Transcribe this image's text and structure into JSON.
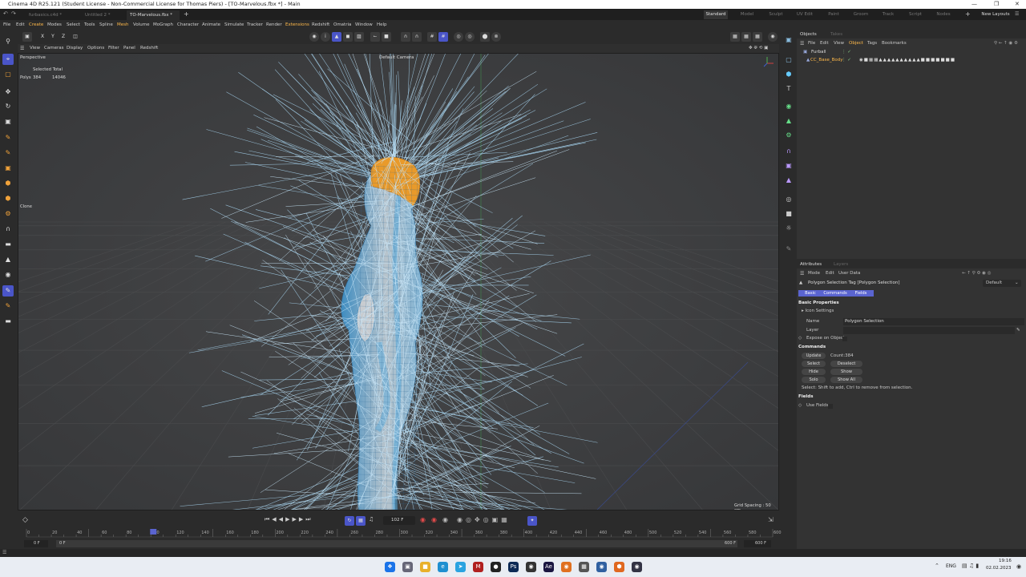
{
  "titlebar": {
    "title": "Cinema 4D R25.121 (Student License - Non-Commercial License for Thomas Piers) - [TO-Marvelous.fbx *] - Main"
  },
  "doc_tabs": [
    {
      "label": "furbasics.c4d *"
    },
    {
      "label": "Untitled 2 *"
    },
    {
      "label": "TO-Marvelous.fbx *"
    }
  ],
  "layout_tabs": [
    "Standard",
    "Model",
    "Sculpt",
    "UV Edit",
    "Paint",
    "Groom",
    "Track",
    "Script",
    "Nodes"
  ],
  "new_layouts": "New Layouts",
  "menus": [
    "File",
    "Edit",
    "Create",
    "Modes",
    "Select",
    "Tools",
    "Spline",
    "Mesh",
    "Volume",
    "MoGraph",
    "Character",
    "Animate",
    "Simulate",
    "Tracker",
    "Render",
    "Extensions",
    "Redshift",
    "Omatria",
    "Window",
    "Help"
  ],
  "axis_buttons": [
    "X",
    "Y",
    "Z"
  ],
  "viewport": {
    "menu": [
      "View",
      "Cameras",
      "Display",
      "Options",
      "Filter",
      "Panel",
      "Redshift"
    ],
    "projection": "Perspective",
    "camera": "Default Camera",
    "stats_header": "Selected Total",
    "stats_label": "Polys",
    "stats_selected": "384",
    "stats_total": "14046",
    "clone_label": "Clone",
    "grid_spacing": "Grid Spacing : 50 cm"
  },
  "objects_panel": {
    "tabs": [
      "Objects",
      "Takes"
    ],
    "menu": [
      "File",
      "Edit",
      "View",
      "Object",
      "Tags",
      "Bookmarks"
    ],
    "items": [
      {
        "name": "Furball"
      },
      {
        "name": "CC_Base_Body"
      }
    ]
  },
  "attributes": {
    "tabs": [
      "Attributes",
      "Layers"
    ],
    "menu": [
      "Mode",
      "Edit",
      "User Data"
    ],
    "title": "Polygon Selection Tag [Polygon Selection]",
    "preset": "Default",
    "subtabs": [
      "Basic",
      "Commands",
      "Fields"
    ],
    "basic_properties": "Basic Properties",
    "icon_settings": "Icon Settings",
    "name_label": "Name",
    "name_value": "Polygon Selection",
    "layer_label": "Layer",
    "expose_label": "Expose on Object",
    "commands_header": "Commands",
    "update": "Update",
    "count": "Count:384",
    "select": "Select",
    "deselect": "Deselect",
    "hide": "Hide",
    "show": "Show",
    "solo": "Solo",
    "show_all": "Show All",
    "hint": "Select: Shift to add, Ctrl to remove from selection.",
    "fields_header": "Fields",
    "use_fields": "Use Fields"
  },
  "timeline": {
    "current_frame": "102 F",
    "ticks": [
      "0",
      "20",
      "40",
      "60",
      "80",
      "100",
      "120",
      "140",
      "160",
      "180",
      "200",
      "220",
      "240",
      "260",
      "280",
      "300",
      "320",
      "340",
      "360",
      "380",
      "400",
      "420",
      "440",
      "460",
      "480",
      "500",
      "520",
      "540",
      "560",
      "580",
      "600"
    ],
    "playhead_frame": 102,
    "max_frame": 600,
    "start_field": "0 F",
    "start_field2": "0 F",
    "end_field": "600 F",
    "end_field2": "600 F"
  },
  "taskbar": {
    "lang": "ENG",
    "time": "19:16",
    "date": "02.02.2023"
  },
  "colors": {
    "accent": "#4a55c8",
    "hair_lines": "#9fd0f0",
    "body_mesh": "#4d9fcf",
    "scalp": "#e99a2a"
  }
}
